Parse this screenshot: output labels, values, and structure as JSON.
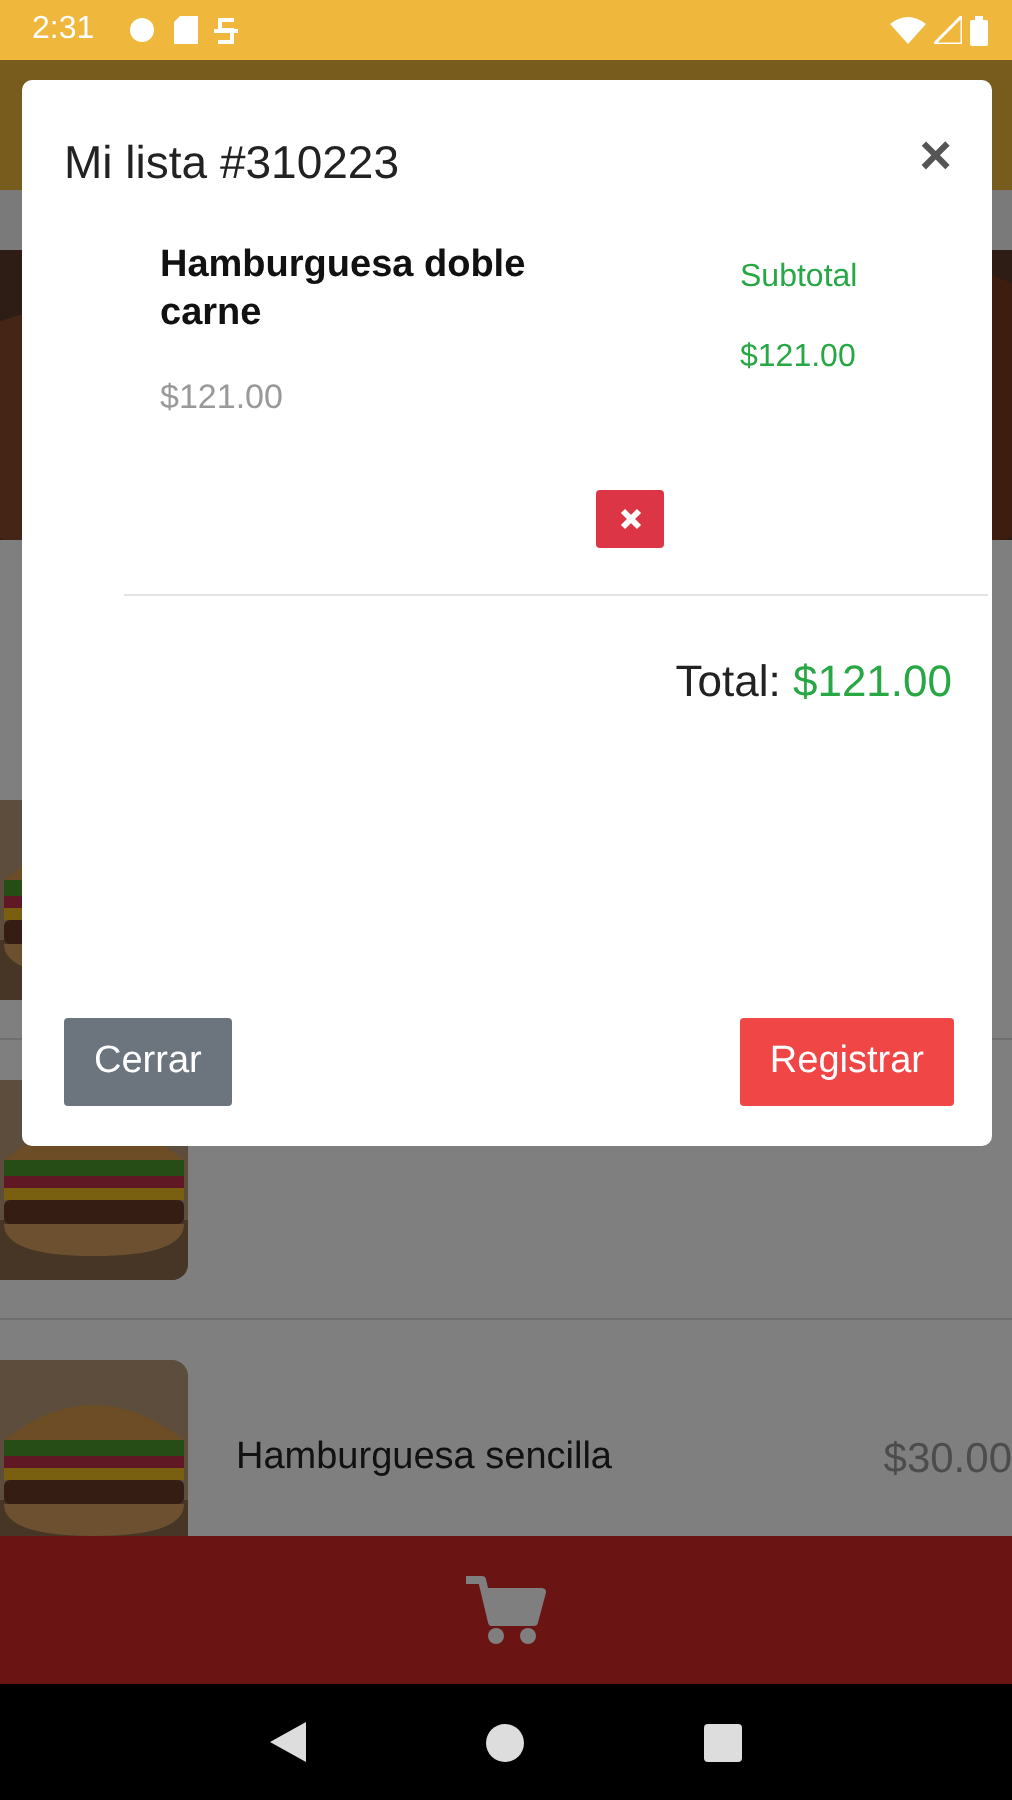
{
  "status_bar": {
    "time": "2:31"
  },
  "menu_rows": [
    {
      "kind": "banner"
    },
    {
      "kind": "row"
    },
    {
      "kind": "row"
    },
    {
      "kind": "row",
      "name": "Hamburguesa sencilla",
      "price": "$30.00"
    }
  ],
  "modal": {
    "title": "Mi lista #310223",
    "close": "×",
    "items": [
      {
        "name": "Hamburguesa doble carne",
        "price": "$121.00",
        "subtotal_label": "Subtotal",
        "subtotal": "$121.00"
      }
    ],
    "total_label": "Total:",
    "total": "$121.00",
    "buttons": [
      {
        "label": "Cerrar",
        "kind": "secondary"
      },
      {
        "label": "Registrar",
        "kind": "danger"
      }
    ]
  }
}
